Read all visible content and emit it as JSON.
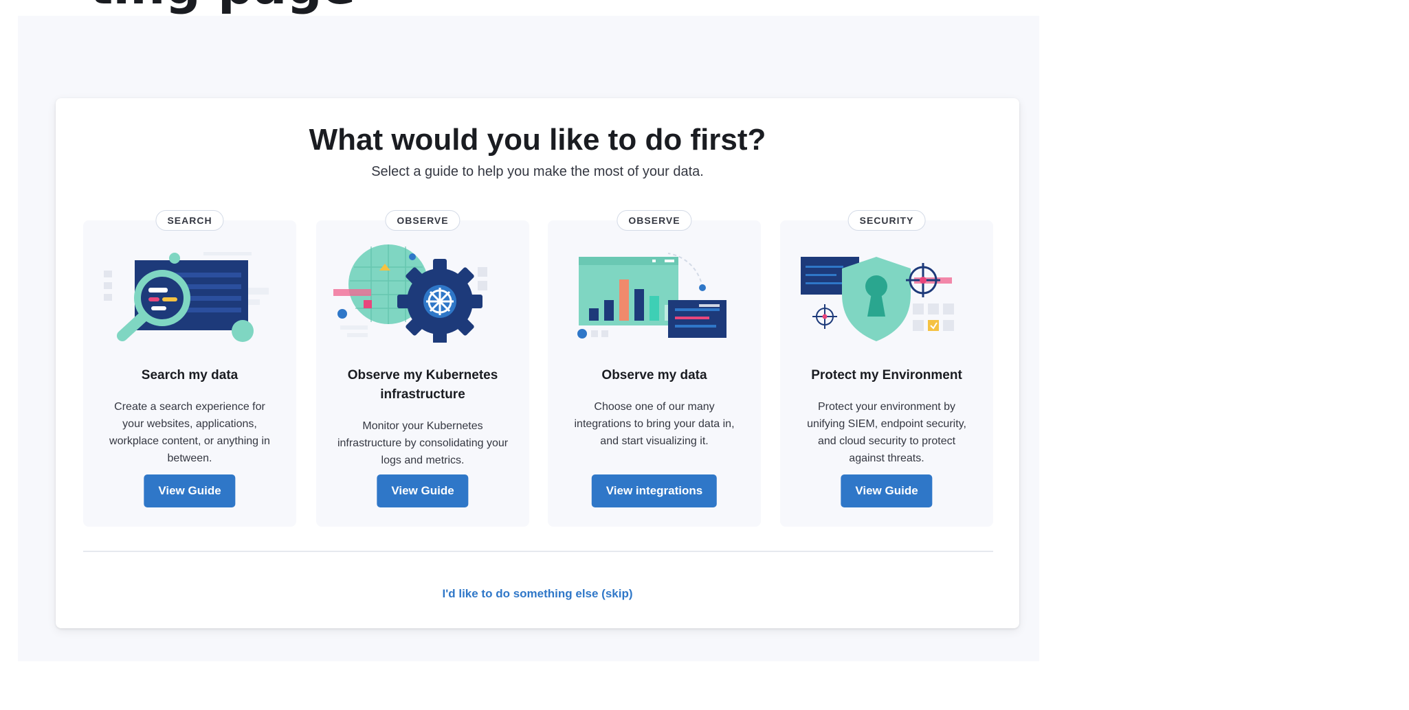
{
  "header": {
    "cutoff_heading": "ting page"
  },
  "onboarding": {
    "title": "What would you like to do first?",
    "subtitle": "Select a guide to help you make the most of your data.",
    "skip_link": "I'd like to do something else (skip)"
  },
  "cards": [
    {
      "badge": "SEARCH",
      "title": "Search my data",
      "description": "Create a search experience for your websites, applications, workplace content, or anything in between.",
      "button": "View Guide",
      "illustration_icon": "magnifier-icon"
    },
    {
      "badge": "OBSERVE",
      "title": "Observe my Kubernetes infrastructure",
      "description": "Monitor your Kubernetes infrastructure by consolidating your logs and metrics.",
      "button": "View Guide",
      "illustration_icon": "kubernetes-wheel-icon"
    },
    {
      "badge": "OBSERVE",
      "title": "Observe my data",
      "description": "Choose one of our many integrations to bring your data in, and start visualizing it.",
      "button": "View integrations",
      "illustration_icon": "bar-chart-icon"
    },
    {
      "badge": "SECURITY",
      "title": "Protect my Environment",
      "description": "Protect your environment by unifying SIEM, endpoint security, and cloud security to protect against threats.",
      "button": "View Guide",
      "illustration_icon": "shield-keyhole-icon"
    }
  ],
  "colors": {
    "primary_button": "#2f77c8",
    "link": "#2f77c8",
    "navy": "#1d3a7a",
    "teal": "#7fd6c2",
    "pink": "#e8467c",
    "yellow": "#f5c242",
    "card_background": "#f7f8fc"
  }
}
